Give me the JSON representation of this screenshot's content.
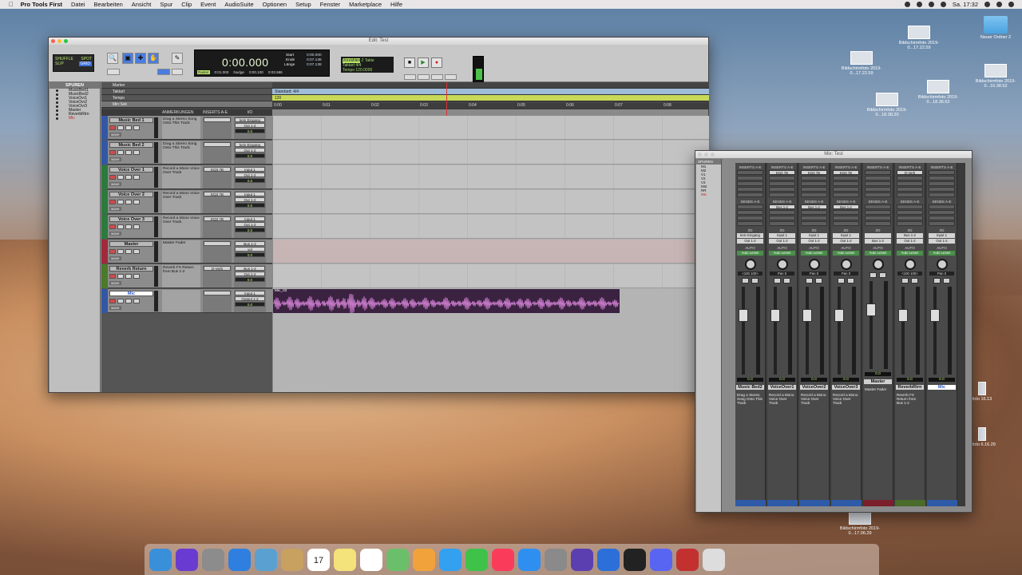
{
  "menubar": {
    "app": "Pro Tools First",
    "items": [
      "Datei",
      "Bearbeiten",
      "Ansicht",
      "Spur",
      "Clip",
      "Event",
      "AudioSuite",
      "Optionen",
      "Setup",
      "Fenster",
      "Marketplace",
      "Hilfe"
    ],
    "clock": "Sa. 17:32"
  },
  "desktop": {
    "icons": [
      {
        "label": "Bildschirmfoto 2019-0...17.22.59"
      },
      {
        "label": "Bildschirmfoto 2019-0...17.22.59"
      },
      {
        "label": "Bildschirmfoto 2019-0...18.36.52"
      },
      {
        "label": "Bildschirmfoto 2019-0...18.38.20"
      },
      {
        "label": "Bildschirmfoto 2019-0...16.38.52"
      },
      {
        "label": "Neuer Ordner 2"
      },
      {
        "label": "Bildschirmfoto 2019-0...17.06.29"
      },
      {
        "label": "foto 16.13"
      },
      {
        "label": "mfoto 6.16.29"
      }
    ]
  },
  "edit": {
    "title": "Edit: Test",
    "modes": {
      "shuffle": "SHUFFLE",
      "spot": "SPOT",
      "slip": "SLIP",
      "grid": "GRID"
    },
    "counter": {
      "main": "0:00.000",
      "start_label": "Start",
      "start": "0:00.000",
      "end_label": "Ende",
      "end": "0:07.138",
      "length_label": "Länge",
      "length": "0:07.138",
      "raster": "Raster",
      "raster_val": "0:01.000",
      "nudge": "Nudge",
      "nudge_val": "0:00.100",
      "cursor": "0:03.586"
    },
    "count": {
      "pre": "Vorzählen",
      "bars": "2 Takte",
      "takt": "Taktart",
      "meter": "4/4",
      "tempo": "Tempo",
      "bpm": "120.0000"
    },
    "tracks_header": "SPUREN",
    "tracklist": [
      "MusicBed1",
      "MusicBed2",
      "VoiceOvr1",
      "VoiceOvr2",
      "VoiceOvr3",
      "Master",
      "ReverbRtrn",
      "Mic"
    ],
    "rulers": {
      "marker": "Marker",
      "taktart": "Taktart",
      "tempo": "Tempo",
      "minsek": "Min:Sek",
      "meter_val": "Standard: 4/4",
      "tempo_val": "120",
      "ticks": [
        "0:00",
        "0:01",
        "0:02",
        "0:03",
        "0:04",
        "0:05",
        "0:06",
        "0:07",
        "0:08"
      ]
    },
    "columns": {
      "comments": "ANMERKUNGEN",
      "inserts": "INSERTS A-E",
      "io": "I/O"
    },
    "tracks": [
      {
        "name": "Music Bed 1",
        "comment": "Drag a Stereo Song Onto This Track",
        "insert": "",
        "io_in": "kein Eingang",
        "io_out": "Out 1-2",
        "vol": "0.0"
      },
      {
        "name": "Music Bed 2",
        "comment": "Drag a Stereo Song Onto This Track",
        "insert": "",
        "io_in": "kein Eingang",
        "io_out": "Out 1-2",
        "vol": "0.0"
      },
      {
        "name": "Voice Over 1",
        "comment": "Record a Mono Voice Over Track",
        "insert": "EQ3 7B",
        "io_in": "Input 1",
        "io_out": "Out 1-2",
        "vol": "0.0"
      },
      {
        "name": "Voice Over 2",
        "comment": "Record a Mono Voice Over Track",
        "insert": "EQ3 7B",
        "io_in": "Input 1",
        "io_out": "Out 1-2",
        "vol": "0.0"
      },
      {
        "name": "Voice Over 3",
        "comment": "Record a Mono Voice Over Track",
        "insert": "EQ3 7B",
        "io_in": "Input 1",
        "io_out": "Out 1-2",
        "vol": "0.0"
      },
      {
        "name": "Master",
        "comment": "Master Fader",
        "insert": "",
        "io_in": "Bus 1-2",
        "io_out": "vol",
        "vol": "0.0"
      },
      {
        "name": "Reverb Return",
        "comment": "Reverb FX Return from Bus 1-2",
        "insert": "D-Verb",
        "io_in": "Bus 1-2",
        "io_out": "Out 1-2",
        "vol": "0.0"
      },
      {
        "name": "Mic",
        "comment": "",
        "insert": "",
        "io_in": "Input 1",
        "io_out": "Output 1-2",
        "vol": "0.0"
      }
    ],
    "master_sub": {
      "a": "Lautstärke",
      "b": "Auto Lesen"
    },
    "clip_name": "Mic_02"
  },
  "mix": {
    "title": "Mix: Test",
    "list": [
      "M1",
      "M2",
      "V1",
      "V2",
      "V3",
      "Mst",
      "RR",
      "Mic"
    ],
    "strips": [
      {
        "name": "Music Bed2",
        "comment": "Drag a Stereo Song Onto This Track",
        "insert": "",
        "send": "",
        "io_in": "kein Eingang",
        "io_out": "Out 1-2",
        "auto": "Auto Lesen",
        "pan": "<100 100>",
        "vol": "0.0",
        "color": "#2e5aa8"
      },
      {
        "name": "VoiceOver1",
        "comment": "Record a Mono Voice Over Track",
        "insert": "EQ3 7B",
        "send": "Bus 1-2",
        "io_in": "Input 1",
        "io_out": "Out 1-2",
        "auto": "Auto Lesen",
        "pan": "Pan  0",
        "vol": "0.0",
        "color": "#2e5aa8"
      },
      {
        "name": "VoiceOver2",
        "comment": "Record a Mono Voice Over Track",
        "insert": "EQ3 7B",
        "send": "Bus 1-2",
        "io_in": "Input 1",
        "io_out": "Out 1-2",
        "auto": "Auto Lesen",
        "pan": "Pan  0",
        "vol": "0.0",
        "color": "#2e5aa8"
      },
      {
        "name": "VoiceOver3",
        "comment": "Record a Mono Voice Over Track",
        "insert": "EQ3 7B",
        "send": "Bus 1-2",
        "io_in": "Input 1",
        "io_out": "Out 1-2",
        "auto": "Auto Lesen",
        "pan": "Pan  0",
        "vol": "0.0",
        "color": "#2e5aa8"
      },
      {
        "name": "Master",
        "comment": "Master Fader",
        "insert": "",
        "send": "",
        "io_in": "",
        "io_out": "Bus 1-2",
        "auto": "Auto Lesen",
        "pan": "",
        "vol": "0.0",
        "color": "#7a1f2b"
      },
      {
        "name": "ReverbRtrn",
        "comment": "Reverb FX Return from Bus 1-2",
        "insert": "D-Verb",
        "send": "",
        "io_in": "Bus 1-2",
        "io_out": "Out 1-2",
        "auto": "Auto Lesen",
        "pan": "<100 100>",
        "vol": "0.0",
        "color": "#4b6b2a"
      },
      {
        "name": "Mic",
        "comment": "",
        "insert": "",
        "send": "",
        "io_in": "Input 1",
        "io_out": "Out 1-2",
        "auto": "Auto Lesen",
        "pan": "Pan  0",
        "vol": "0.0",
        "color": "#2e5aa8"
      }
    ],
    "labels": {
      "inserts": "INSERTS A-E",
      "sends": "SENDS A-E",
      "io": "I/O",
      "auto": "AUTO"
    }
  },
  "dock": {
    "apps": [
      "Finder",
      "Siri",
      "Launchpad",
      "Safari",
      "Vorschau",
      "Notizen",
      "Kalender",
      "Notes",
      "Erinnerungen",
      "Karten",
      "Fotos",
      "Nachrichten",
      "FaceTime",
      "Musik",
      "App Store",
      "Systemeinstellungen",
      "Pro Tools",
      "Xcode",
      "Klavier",
      "Discord",
      "Photo Booth",
      "Papierkorb"
    ],
    "calendar_day": "17"
  }
}
